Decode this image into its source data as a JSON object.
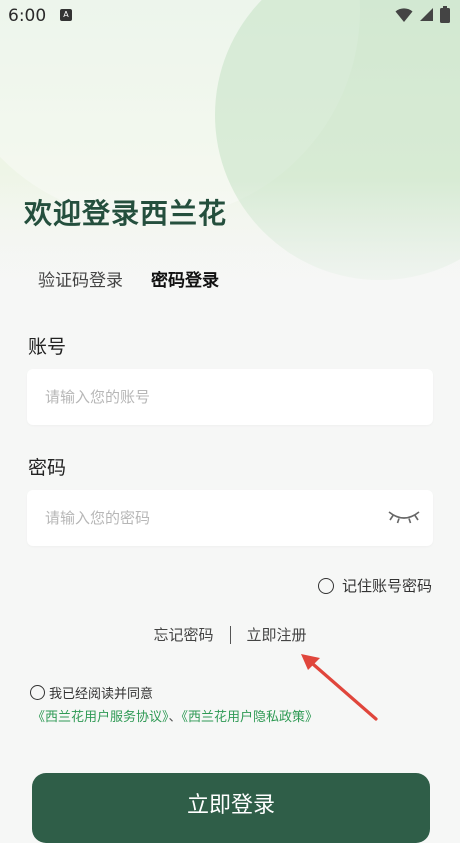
{
  "status_bar": {
    "time": "6:00",
    "notification_badge": "A",
    "icons": [
      "wifi-icon",
      "signal-icon",
      "battery-icon"
    ]
  },
  "welcome_title": "欢迎登录西兰花",
  "tabs": [
    {
      "label": "验证码登录",
      "active": false
    },
    {
      "label": "密码登录",
      "active": true
    }
  ],
  "account": {
    "label": "账号",
    "value": "",
    "placeholder": "请输入您的账号"
  },
  "password": {
    "label": "密码",
    "value": "",
    "placeholder": "请输入您的密码",
    "icon": "eye-closed-icon"
  },
  "remember": {
    "label": "记住账号密码",
    "checked": false
  },
  "links": {
    "forgot": "忘记密码",
    "register": "立即注册"
  },
  "agreement": {
    "text": "我已经阅读并同意",
    "checked": false,
    "service_link": "《西兰花用户服务协议》",
    "separator": "、",
    "privacy_link": "《西兰花用户隐私政策》"
  },
  "login_button": "立即登录",
  "colors": {
    "brand_dark": "#2f5e48",
    "title": "#244f3d",
    "link_green": "#2f9a55",
    "annotation_arrow": "#e0463c"
  }
}
